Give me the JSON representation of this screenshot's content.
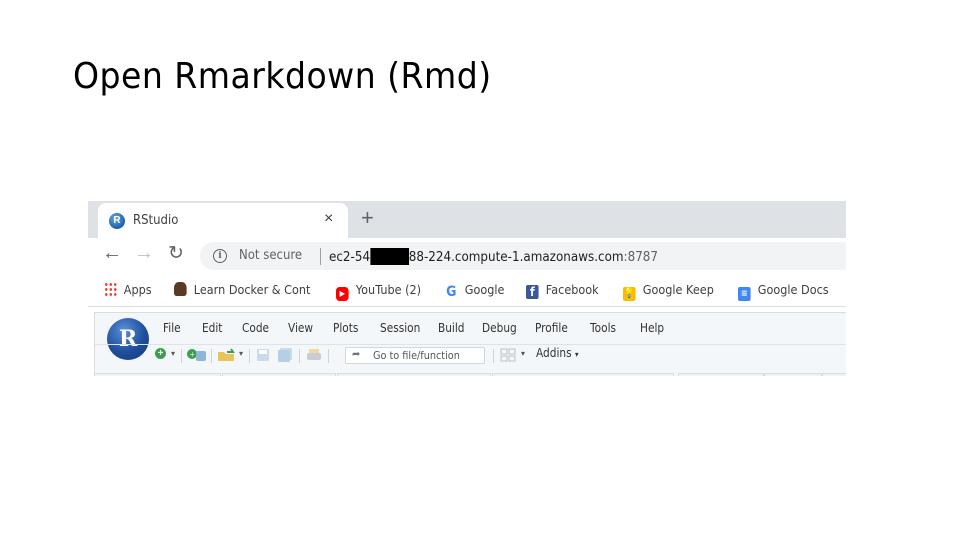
{
  "slide": {
    "title": "Open Rmarkdown (Rmd)"
  },
  "browser": {
    "tab": {
      "title": "RStudio",
      "favicon": "R",
      "close_icon": "×",
      "new_tab_icon": "+"
    },
    "nav": {
      "back_icon": "←",
      "forward_icon": "→",
      "reload_icon": "↻"
    },
    "omnibox": {
      "security_icon": "i",
      "security_label": "Not secure",
      "url_prefix": "ec2-54",
      "url_suffix": "88-224.compute-1.amazonaws.com",
      "url_port": ":8787"
    },
    "bookmarks": [
      {
        "label": "Apps",
        "icon": "apps-grid-icon"
      },
      {
        "label": "Learn Docker & Cont",
        "icon": "docker-icon"
      },
      {
        "label": "YouTube (2)",
        "icon": "youtube-icon"
      },
      {
        "label": "Google",
        "icon": "google-icon"
      },
      {
        "label": "Facebook",
        "icon": "facebook-icon"
      },
      {
        "label": "Google Keep",
        "icon": "google-keep-icon"
      },
      {
        "label": "Google Docs",
        "icon": "google-docs-icon"
      }
    ]
  },
  "rstudio": {
    "logo": "R",
    "menu": [
      "File",
      "Edit",
      "Code",
      "View",
      "Plots",
      "Session",
      "Build",
      "Debug",
      "Profile",
      "Tools",
      "Help"
    ],
    "toolbar": {
      "goto_placeholder": "Go to file/function",
      "addins_label": "Addins",
      "dropdown_glyph": "▾"
    }
  }
}
